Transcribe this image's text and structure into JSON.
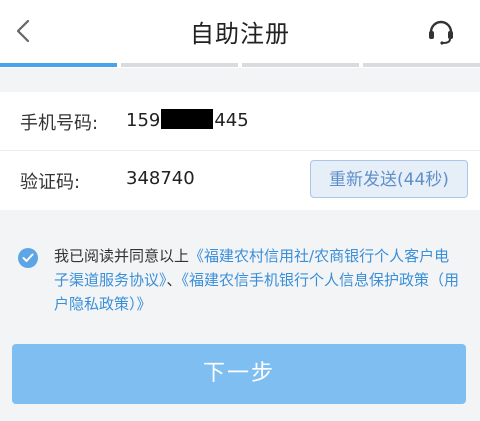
{
  "header": {
    "title": "自助注册",
    "back_icon": "chevron-left-icon",
    "support_icon": "headset-icon"
  },
  "progress": {
    "total_steps": 4,
    "current_step": 1
  },
  "form": {
    "phone": {
      "label": "手机号码:",
      "prefix": "159",
      "suffix": "445"
    },
    "code": {
      "label": "验证码:",
      "value": "348740",
      "resend_label": "重新发送(44秒)"
    }
  },
  "agreement": {
    "checked": true,
    "prefix": "我已阅读并同意以上",
    "link1": "《福建农村信用社/农商银行个人客户电子渠道服务协议》",
    "separator": "、",
    "link2": "《福建农信手机银行个人信息保护政策（用户隐私政策）》"
  },
  "next_button": {
    "label": "下一步"
  },
  "colors": {
    "accent": "#4aa3ea",
    "link": "#3a8fd8",
    "button": "#7fbef0",
    "resend_text": "#5f8fc9"
  }
}
